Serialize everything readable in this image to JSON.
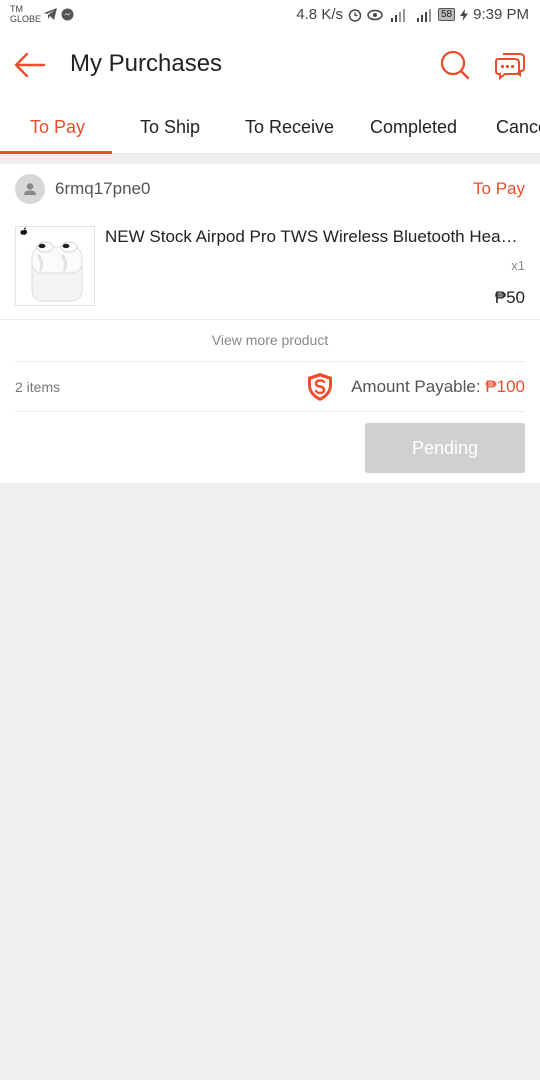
{
  "status_bar": {
    "carrier_line1": "TM",
    "carrier_line2": "GLOBE",
    "speed": "4.8 K/s",
    "battery": "58",
    "time": "9:39 PM"
  },
  "header": {
    "title": "My Purchases"
  },
  "tabs": [
    {
      "label": "To Pay",
      "active": true
    },
    {
      "label": "To Ship",
      "active": false
    },
    {
      "label": "To Receive",
      "active": false
    },
    {
      "label": "Completed",
      "active": false
    },
    {
      "label": "Cancelled",
      "active": false
    }
  ],
  "order": {
    "shop_name": "6rmq17pne0",
    "status": "To Pay",
    "product": {
      "name": "NEW Stock Airpod Pro TWS Wireless Bluetooth Headset",
      "quantity": "x1",
      "price": "₱50"
    },
    "view_more": "View more product",
    "items_count": "2 items",
    "amount_label": "Amount Payable: ",
    "amount_value": "₱100",
    "action_button": "Pending"
  },
  "colors": {
    "accent": "#ee4d2d",
    "disabled_button": "#d0d0d0",
    "background": "#efefef"
  }
}
